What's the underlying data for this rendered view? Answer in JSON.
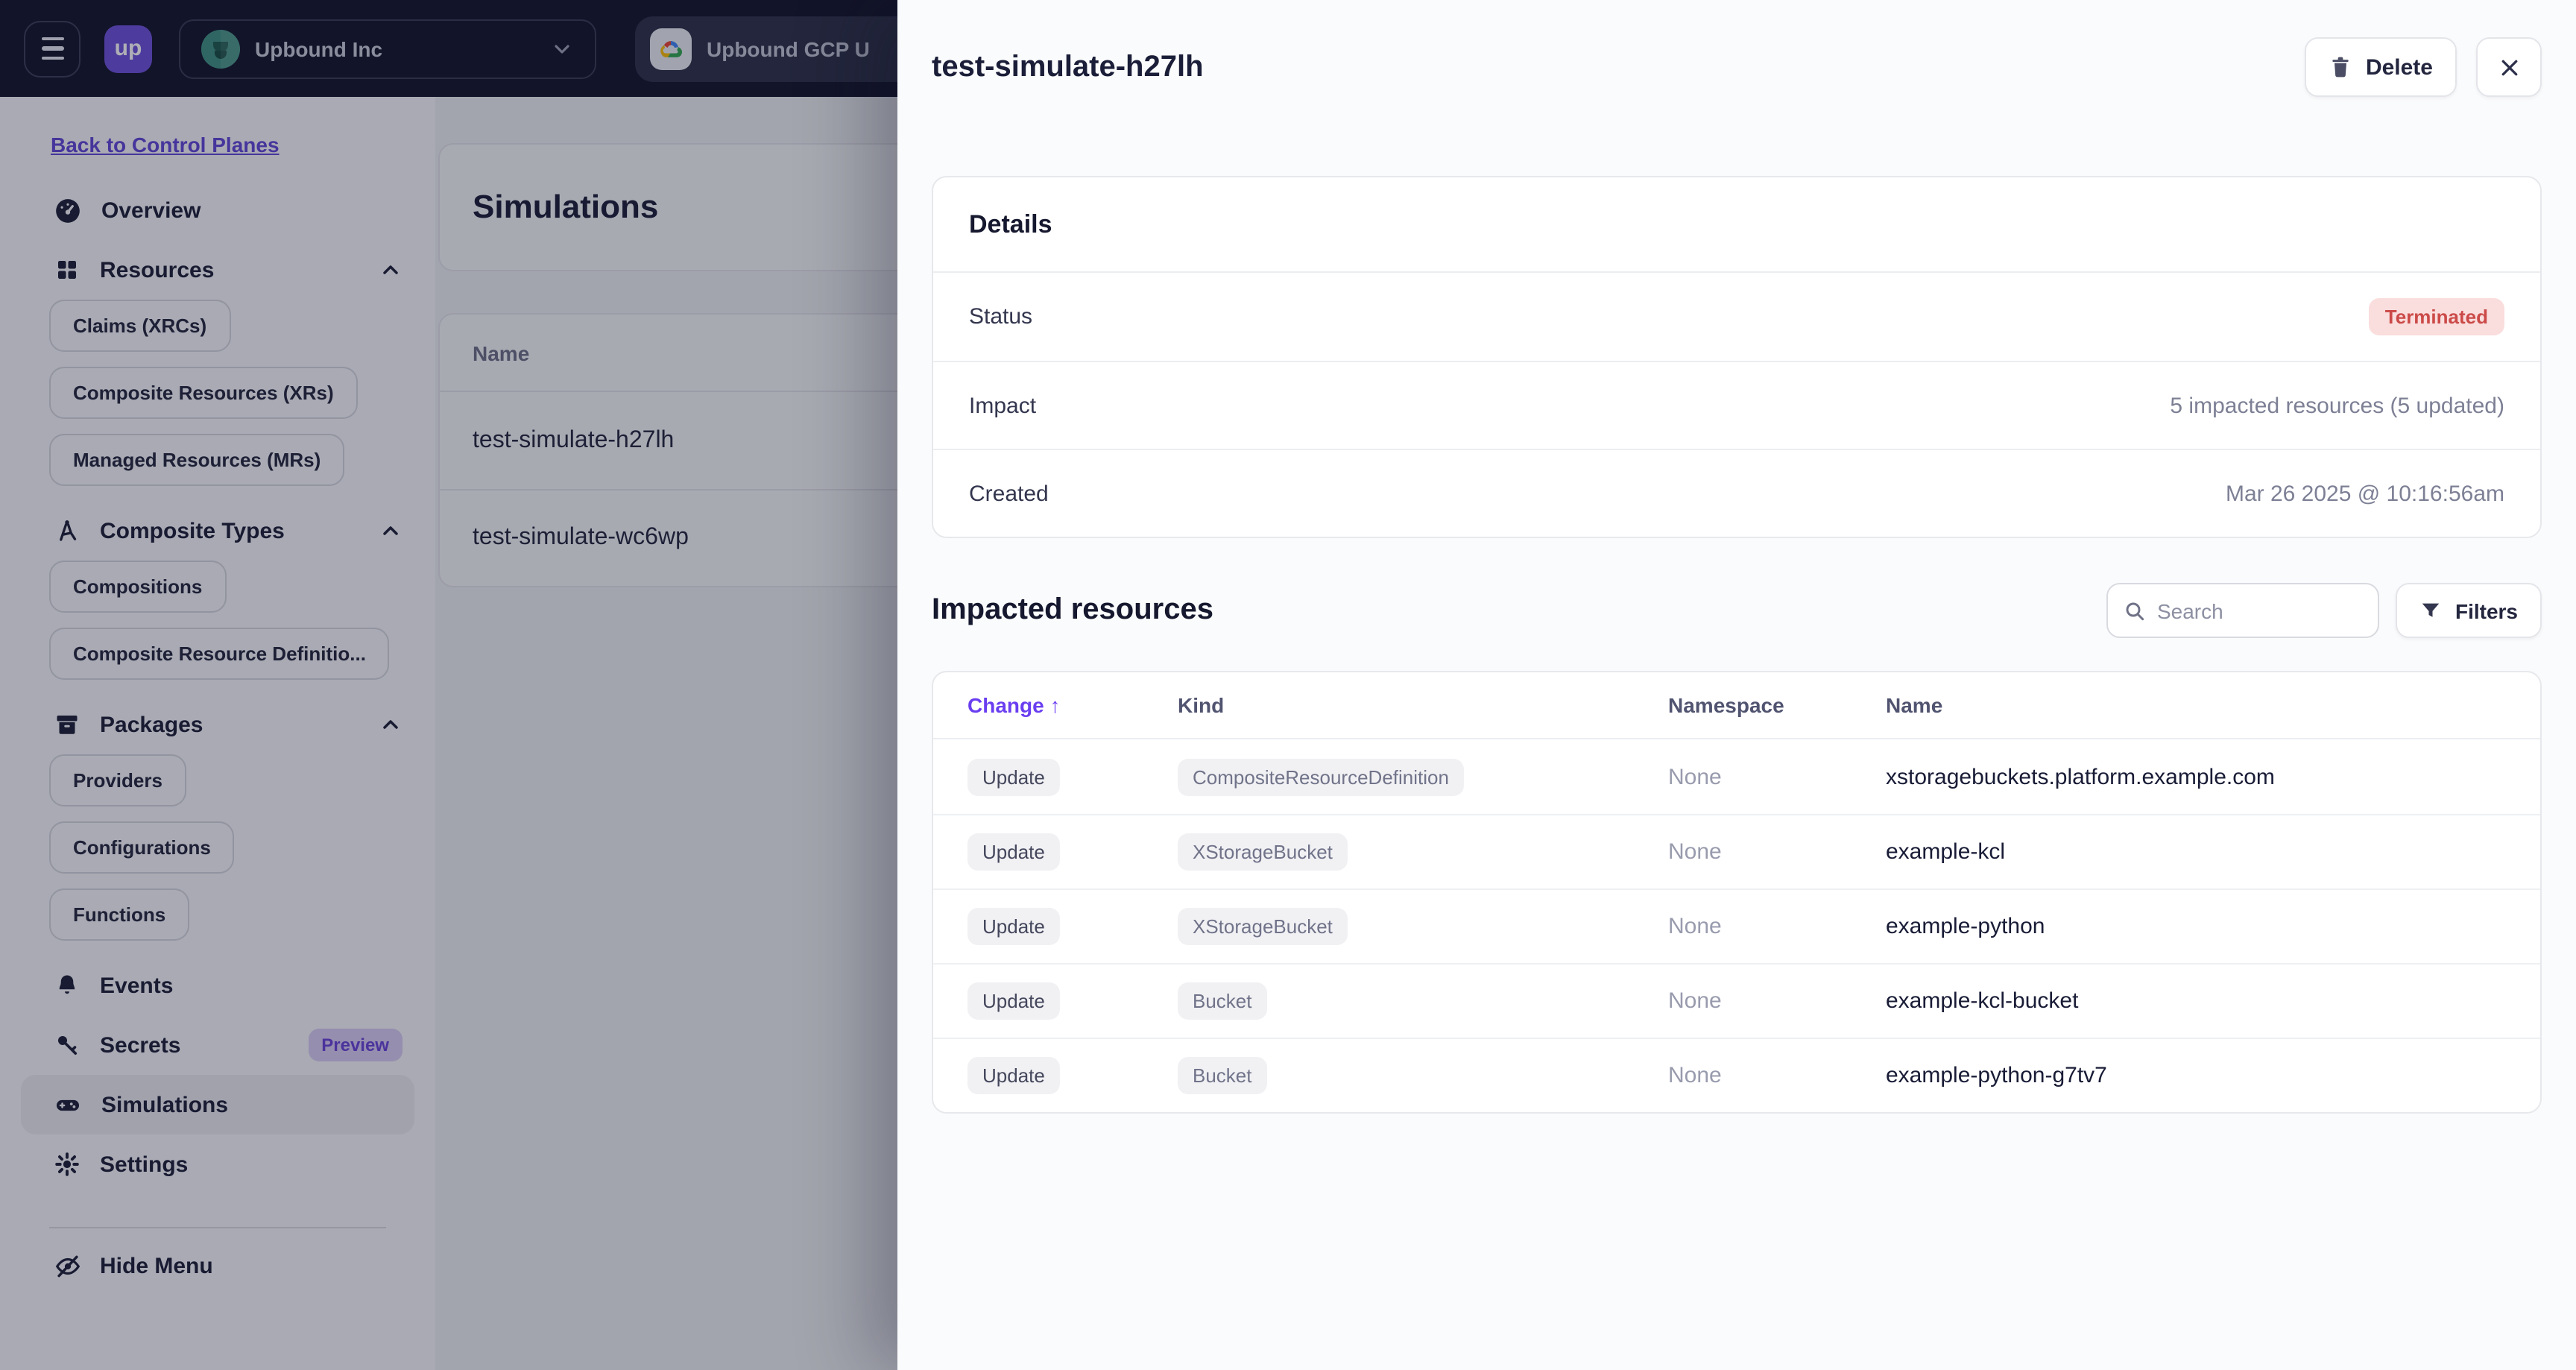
{
  "topbar": {
    "logo_text": "up",
    "org_name": "Upbound Inc",
    "control_plane_name": "Upbound GCP U"
  },
  "sidebar": {
    "back_link": "Back to Control Planes",
    "items": [
      {
        "label": "Overview"
      },
      {
        "label": "Resources",
        "children": [
          "Claims (XRCs)",
          "Composite Resources (XRs)",
          "Managed Resources (MRs)"
        ]
      },
      {
        "label": "Composite Types",
        "children": [
          "Compositions",
          "Composite Resource Definitio..."
        ]
      },
      {
        "label": "Packages",
        "children": [
          "Providers",
          "Configurations",
          "Functions"
        ]
      },
      {
        "label": "Events"
      },
      {
        "label": "Secrets",
        "badge": "Preview"
      },
      {
        "label": "Simulations",
        "active": true
      },
      {
        "label": "Settings"
      }
    ],
    "hide_menu_label": "Hide Menu"
  },
  "main": {
    "title": "Simulations",
    "table": {
      "name_column": "Name",
      "rows": [
        {
          "name": "test-simulate-h27lh"
        },
        {
          "name": "test-simulate-wc6wp"
        }
      ]
    }
  },
  "panel": {
    "title": "test-simulate-h27lh",
    "delete_label": "Delete",
    "details": {
      "heading": "Details",
      "status_label": "Status",
      "status_value": "Terminated",
      "impact_label": "Impact",
      "impact_value": "5 impacted resources (5 updated)",
      "created_label": "Created",
      "created_value": "Mar 26 2025 @ 10:16:56am"
    },
    "impacted": {
      "heading": "Impacted resources",
      "search_placeholder": "Search",
      "filters_label": "Filters",
      "sort_icon": "↑",
      "columns": {
        "change": "Change",
        "kind": "Kind",
        "namespace": "Namespace",
        "name": "Name"
      },
      "rows": [
        {
          "change": "Update",
          "kind": "CompositeResourceDefinition",
          "namespace": "None",
          "name": "xstoragebuckets.platform.example.com"
        },
        {
          "change": "Update",
          "kind": "XStorageBucket",
          "namespace": "None",
          "name": "example-kcl"
        },
        {
          "change": "Update",
          "kind": "XStorageBucket",
          "namespace": "None",
          "name": "example-python"
        },
        {
          "change": "Update",
          "kind": "Bucket",
          "namespace": "None",
          "name": "example-kcl-bucket"
        },
        {
          "change": "Update",
          "kind": "Bucket",
          "namespace": "None",
          "name": "example-python-g7tv7"
        }
      ]
    }
  },
  "colors": {
    "brand_purple": "#6d51da",
    "link_purple": "#6246d8",
    "sorted_column_purple": "#6a3ef0",
    "status_terminated_bg": "#fadddd",
    "status_terminated_text": "#cb4a48",
    "topbar_bg": "#13152a"
  }
}
